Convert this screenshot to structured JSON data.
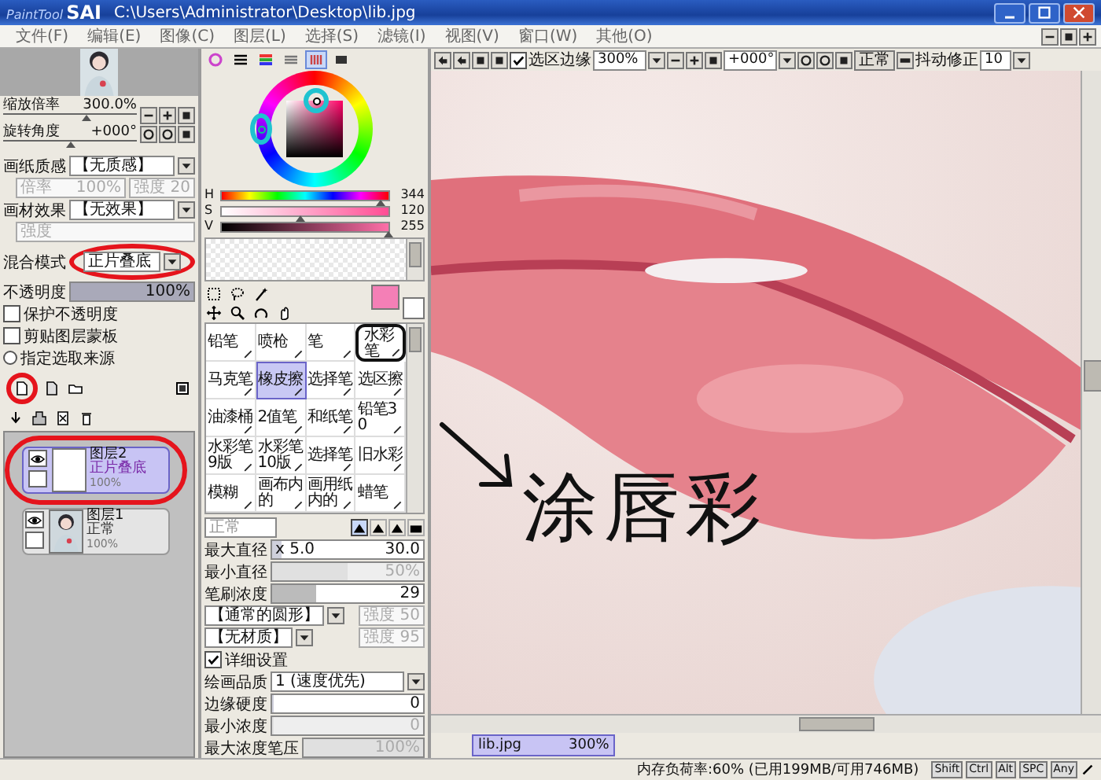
{
  "window": {
    "logo_prefix": "PaintTool",
    "logo": "SAI",
    "title": "C:\\Users\\Administrator\\Desktop\\lib.jpg"
  },
  "menu": [
    "文件(F)",
    "编辑(E)",
    "图像(C)",
    "图层(L)",
    "选择(S)",
    "滤镜(I)",
    "视图(V)",
    "窗口(W)",
    "其他(O)"
  ],
  "navigator": {
    "zoom": {
      "label": "缩放倍率",
      "value": "300.0%",
      "level": 0.62
    },
    "rotate": {
      "label": "旋转角度",
      "value": "+000°",
      "level": 0.5
    }
  },
  "layer_props": {
    "texture": {
      "label": "画纸质感",
      "value": "【无质感】"
    },
    "texture_scale": {
      "label": "倍率",
      "value": "100%",
      "strength_label": "强度",
      "strength": "20",
      "disabled": true
    },
    "effect": {
      "label": "画材效果",
      "value": "【无效果】"
    },
    "effect_strength": {
      "label": "强度",
      "disabled": true
    },
    "blend": {
      "label": "混合模式",
      "value": "正片叠底"
    },
    "opacity": {
      "label": "不透明度",
      "value": "100%",
      "level": 1
    },
    "checks": [
      {
        "label": "保护不透明度",
        "checked": false
      },
      {
        "label": "剪贴图层蒙板",
        "checked": false
      }
    ],
    "radio": {
      "label": "指定选取来源",
      "selected": false
    }
  },
  "layers": [
    {
      "name": "图层2",
      "mode": "正片叠底",
      "opacity": "100%",
      "visible": true,
      "selected": true,
      "kind": "blank"
    },
    {
      "name": "图层1",
      "mode": "正常",
      "opacity": "100%",
      "visible": true,
      "selected": false,
      "kind": "picture"
    }
  ],
  "color_sliders": [
    {
      "label": "H",
      "value": "344",
      "level": 0.95,
      "kind": "hue"
    },
    {
      "label": "S",
      "value": "120",
      "level": 0.47,
      "kind": "sat"
    },
    {
      "label": "V",
      "value": "255",
      "level": 1,
      "kind": "val"
    }
  ],
  "brushes": [
    {
      "label": "铅笔",
      "selected": false
    },
    {
      "label": "喷枪",
      "selected": false
    },
    {
      "label": "笔",
      "selected": false
    },
    {
      "label": "水彩笔",
      "selected": false
    },
    {
      "label": "马克笔",
      "selected": false
    },
    {
      "label": "橡皮擦",
      "selected": true
    },
    {
      "label": "选择笔",
      "selected": false
    },
    {
      "label": "选区擦",
      "selected": false
    },
    {
      "label": "油漆桶",
      "selected": false
    },
    {
      "label": "2值笔",
      "selected": false
    },
    {
      "label": "和纸笔",
      "selected": false
    },
    {
      "label": "铅笔30",
      "selected": false
    },
    {
      "label": "水彩笔9版",
      "selected": false
    },
    {
      "label": "水彩笔10版",
      "selected": false
    },
    {
      "label": "选择笔",
      "selected": false
    },
    {
      "label": "旧水彩",
      "selected": false
    },
    {
      "label": "模糊",
      "selected": false
    },
    {
      "label": "画布内的",
      "selected": false
    },
    {
      "label": "画用纸内的",
      "selected": false
    },
    {
      "label": "蜡笔",
      "selected": false
    }
  ],
  "brush_settings": {
    "mode": "正常",
    "max_size": {
      "label": "最大直径",
      "multiplier": "x 5.0",
      "value": "30.0",
      "level": 0.06
    },
    "min_size": {
      "label": "最小直径",
      "value": "50%",
      "level": 0.5,
      "disabled": true
    },
    "density": {
      "label": "笔刷浓度",
      "value": "29",
      "level": 0.29
    },
    "shape": {
      "value": "【通常的圆形】",
      "strength_label": "强度",
      "strength": "50",
      "disabled": true
    },
    "texture": {
      "value": "【无材质】",
      "strength_label": "强度",
      "strength": "95",
      "disabled": true
    },
    "advanced": {
      "label": "详细设置",
      "checked": true
    },
    "quality": {
      "label": "绘画品质",
      "value": "1 (速度优先)"
    },
    "edge_hardness": {
      "label": "边缘硬度",
      "value": "0",
      "level": 0,
      "disabled": false
    },
    "min_density": {
      "label": "最小浓度",
      "value": "0",
      "level": 0,
      "disabled": true
    },
    "max_pressure": {
      "label": "最大浓度笔压",
      "value": "100%",
      "level": 1,
      "disabled": true
    }
  },
  "canvas_toolbar": {
    "selection_edge": {
      "label": "选区边缘",
      "checked": true
    },
    "zoom": "300%",
    "rotation": "+000°",
    "mode": "正常",
    "stabilizer": {
      "label": "抖动修正",
      "value": "10"
    }
  },
  "canvas": {
    "annotation": "涂唇彩"
  },
  "doc_tabs": [
    {
      "name": "lib.jpg",
      "zoom": "300%",
      "selected": true
    }
  ],
  "status": {
    "memory": "内存负荷率:60% (已用199MB/可用746MB)",
    "keys": [
      "Shift",
      "Ctrl",
      "Alt",
      "SPC",
      "Any"
    ]
  }
}
